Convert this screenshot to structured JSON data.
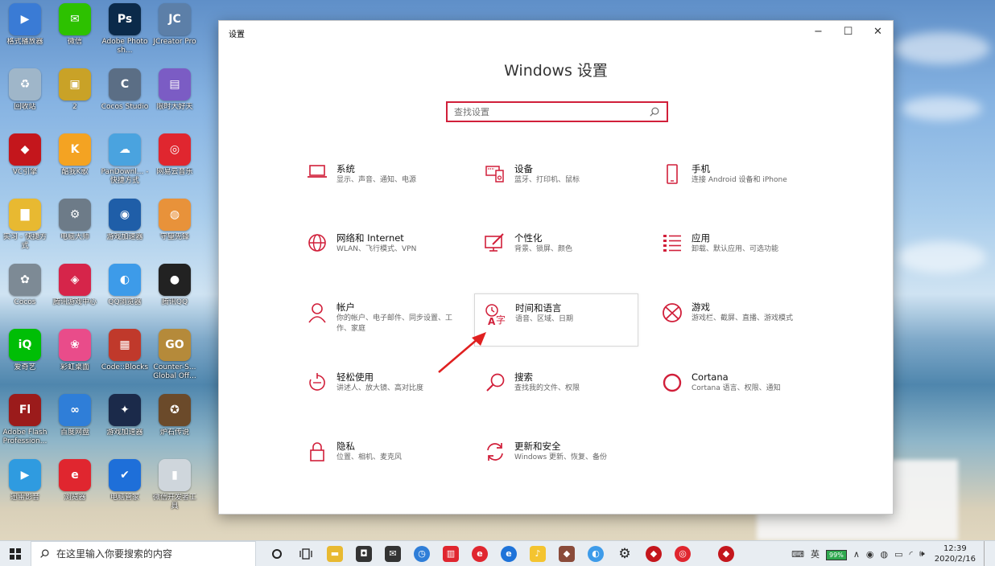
{
  "desktop": {
    "icons": [
      {
        "label": "格式播放器",
        "glyph": "▶",
        "color": "#3a7bd5"
      },
      {
        "label": "微信",
        "glyph": "✉",
        "color": "#2dc100"
      },
      {
        "label": "Adobe Photosh...",
        "glyph": "Ps",
        "color": "#0b2a4a"
      },
      {
        "label": "JCreator Pro",
        "glyph": "JC",
        "color": "#5c7fa8"
      },
      {
        "label": "回收站",
        "glyph": "♻",
        "color": "#9fb6c9"
      },
      {
        "label": "2",
        "glyph": "▣",
        "color": "#c9a227"
      },
      {
        "label": "Cocos Studio",
        "glyph": "C",
        "color": "#5b6e85"
      },
      {
        "label": "限时大好天",
        "glyph": "▤",
        "color": "#7b5cc4"
      },
      {
        "label": "VC引擎",
        "glyph": "◆",
        "color": "#c4161c"
      },
      {
        "label": "酷我K歌",
        "glyph": "K",
        "color": "#f4a322"
      },
      {
        "label": "PanDownl... - 快捷方式",
        "glyph": "☁",
        "color": "#4aa3df"
      },
      {
        "label": "网易云音乐",
        "glyph": "◎",
        "color": "#e0262f"
      },
      {
        "label": "实习 - 快捷方式",
        "glyph": "▇",
        "color": "#e8b931"
      },
      {
        "label": "电脑大师",
        "glyph": "⚙",
        "color": "#6d7b88"
      },
      {
        "label": "游戏加速器",
        "glyph": "◉",
        "color": "#1f5ea8"
      },
      {
        "label": "守望先锋",
        "glyph": "◍",
        "color": "#e8923a"
      },
      {
        "label": "Cocos",
        "glyph": "✿",
        "color": "#7d8a95"
      },
      {
        "label": "腾讯游戏中心",
        "glyph": "◈",
        "color": "#d6254a"
      },
      {
        "label": "QQ浏览器",
        "glyph": "◐",
        "color": "#3d9be9"
      },
      {
        "label": "腾讯QQ",
        "glyph": "●",
        "color": "#222222"
      },
      {
        "label": "爱奇艺",
        "glyph": "iQ",
        "color": "#00be06"
      },
      {
        "label": "彩虹桌面",
        "glyph": "❀",
        "color": "#e94c8a"
      },
      {
        "label": "Code::Blocks",
        "glyph": "▦",
        "color": "#c0392b"
      },
      {
        "label": "Counter-S... Global Off...",
        "glyph": "GO",
        "color": "#b58a3a"
      },
      {
        "label": "Adobe Flash Profession...",
        "glyph": "Fl",
        "color": "#9b1b1b"
      },
      {
        "label": "百度网盘",
        "glyph": "∞",
        "color": "#2f7ed8"
      },
      {
        "label": "游戏加速器",
        "glyph": "✦",
        "color": "#1b2a4a"
      },
      {
        "label": "炉石传说",
        "glyph": "✪",
        "color": "#6b4a2a"
      },
      {
        "label": "迅雷影音",
        "glyph": "▶",
        "color": "#2f9be0"
      },
      {
        "label": "浏览器",
        "glyph": "e",
        "color": "#e0262f"
      },
      {
        "label": "电脑管家",
        "glyph": "✔",
        "color": "#1e6fd9"
      },
      {
        "label": "微信开发者工具",
        "glyph": "▮",
        "color": "#cfd6dc"
      }
    ]
  },
  "window": {
    "title": "设置",
    "controls": {
      "minimize": "−",
      "maximize": "☐",
      "close": "✕"
    },
    "heading": "Windows 设置",
    "search_placeholder": "查找设置",
    "tiles": [
      {
        "name": "系统",
        "desc": "显示、声音、通知、电源",
        "icon": "laptop-icon"
      },
      {
        "name": "设备",
        "desc": "蓝牙、打印机、鼠标",
        "icon": "devices-icon"
      },
      {
        "name": "手机",
        "desc": "连接 Android 设备和 iPhone",
        "icon": "phone-icon"
      },
      {
        "name": "网络和 Internet",
        "desc": "WLAN、飞行模式、VPN",
        "icon": "globe-icon"
      },
      {
        "name": "个性化",
        "desc": "背景、锁屏、颜色",
        "icon": "personalize-icon"
      },
      {
        "name": "应用",
        "desc": "卸载、默认应用、可选功能",
        "icon": "apps-list-icon"
      },
      {
        "name": "帐户",
        "desc": "你的帐户、电子邮件、同步设置、工作、家庭",
        "icon": "person-icon"
      },
      {
        "name": "时间和语言",
        "desc": "语音、区域、日期",
        "icon": "time-language-icon"
      },
      {
        "name": "游戏",
        "desc": "游戏栏、截屏、直播、游戏模式",
        "icon": "xbox-icon"
      },
      {
        "name": "轻松使用",
        "desc": "讲述人、放大镜、高对比度",
        "icon": "ease-of-access-icon"
      },
      {
        "name": "搜索",
        "desc": "查找我的文件、权限",
        "icon": "search-icon"
      },
      {
        "name": "Cortana",
        "desc": "Cortana 语言、权限、通知",
        "icon": "cortana-icon"
      },
      {
        "name": "隐私",
        "desc": "位置、相机、麦克风",
        "icon": "lock-icon"
      },
      {
        "name": "更新和安全",
        "desc": "Windows 更新、恢复、备份",
        "icon": "update-icon"
      }
    ],
    "accent_color": "#d11f3a"
  },
  "taskbar": {
    "search_text": "在这里输入你要搜索的内容",
    "battery": "99%",
    "ime": "英",
    "time": "12:39",
    "date": "2020/2/16"
  }
}
